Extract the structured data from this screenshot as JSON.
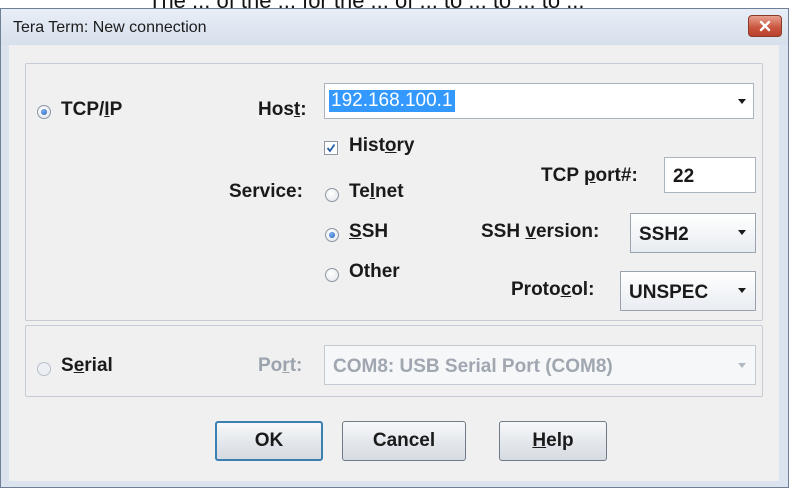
{
  "top_clipped_text": "The ... of the ... for the ... of ... to ... to ... to ...",
  "window": {
    "title": "Tera Term: New connection",
    "close_glyph": "✕"
  },
  "tcp": {
    "radio_label_pre": "TCP/",
    "radio_label_u": "I",
    "radio_label_post": "P",
    "selected": true,
    "host_label_pre": "Hos",
    "host_label_u": "t",
    "host_label_post": ":",
    "host_value": "192.168.100.1",
    "history_label_pre": "Hist",
    "history_label_u": "o",
    "history_label_post": "ry",
    "history_checked": true,
    "service_label": "Service:",
    "tcp_port_label_pre": "TCP ",
    "tcp_port_label_u": "p",
    "tcp_port_label_post": "ort#:",
    "tcp_port_value": "22",
    "services": [
      {
        "pre": "Te",
        "u": "l",
        "post": "net",
        "selected": false
      },
      {
        "pre": "",
        "u": "S",
        "post": "SH",
        "selected": true
      },
      {
        "pre": "Other",
        "u": "",
        "post": "",
        "selected": false
      }
    ],
    "ssh_version_label_pre": "SSH ",
    "ssh_version_label_u": "v",
    "ssh_version_label_post": "ersion:",
    "ssh_version_value": "SSH2",
    "protocol_label_pre": "Proto",
    "protocol_label_u": "c",
    "protocol_label_post": "ol:",
    "protocol_value": "UNSPEC"
  },
  "serial": {
    "radio_label_pre": "S",
    "radio_label_u": "e",
    "radio_label_post": "rial",
    "selected": false,
    "port_label_pre": "Po",
    "port_label_u": "r",
    "port_label_post": "t:",
    "port_value": "COM8: USB Serial Port (COM8)"
  },
  "buttons": {
    "ok": "OK",
    "cancel": "Cancel",
    "help_u": "H",
    "help_post": "elp"
  },
  "icons": {
    "dropdown": "chevron-down-icon",
    "check": "checkmark-icon",
    "close": "close-icon"
  }
}
